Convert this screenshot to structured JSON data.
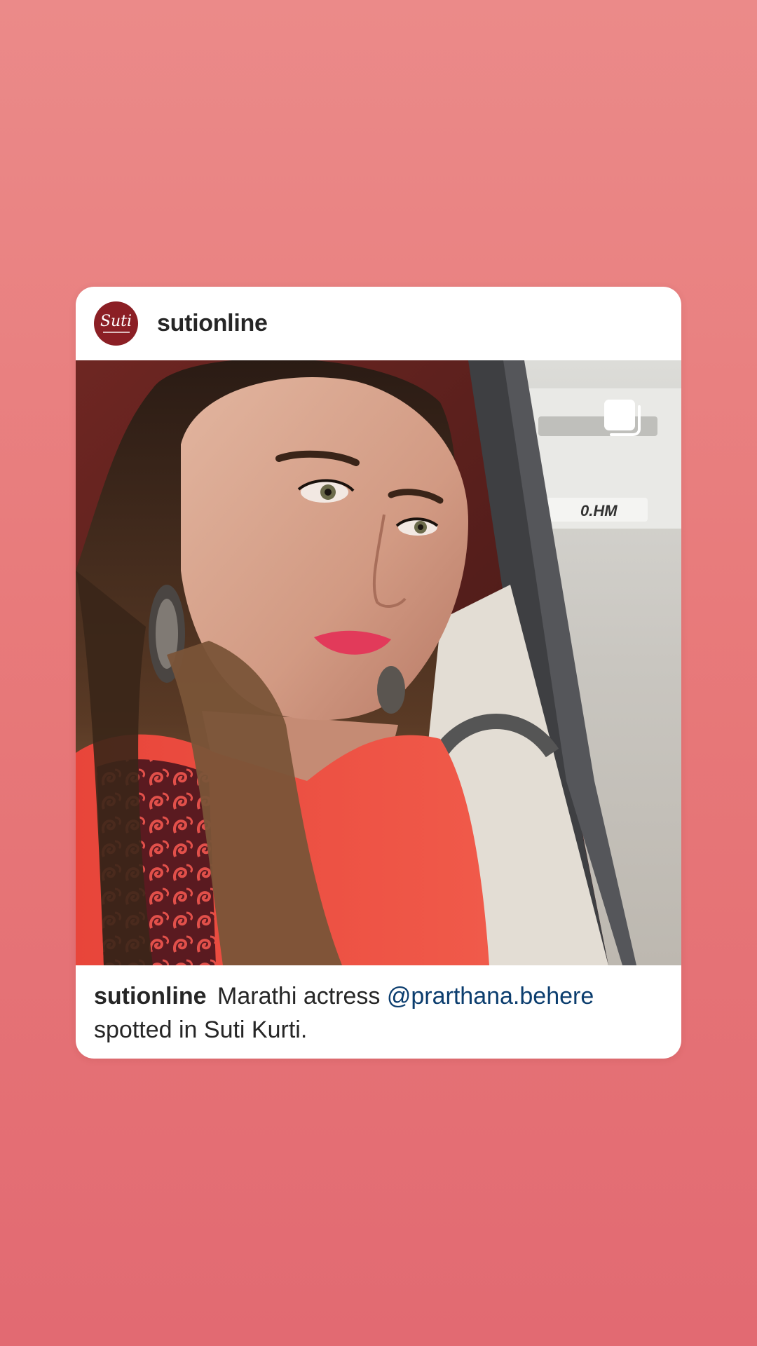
{
  "post": {
    "username": "sutionline",
    "avatar": {
      "logo_text": "Suti",
      "color": "#8b1f25"
    },
    "photo": {
      "plate_text": "0.HM",
      "icon": "multiple-posts-icon"
    },
    "caption": {
      "username": "sutionline",
      "text_before": "Marathi actress",
      "mention": "@prarthana.behere",
      "text_after": "spotted in Suti Kurti."
    }
  },
  "colors": {
    "background_top": "#eb8a89",
    "background_bottom": "#e26a72",
    "card": "#ffffff",
    "mention": "#0b3d6e"
  }
}
